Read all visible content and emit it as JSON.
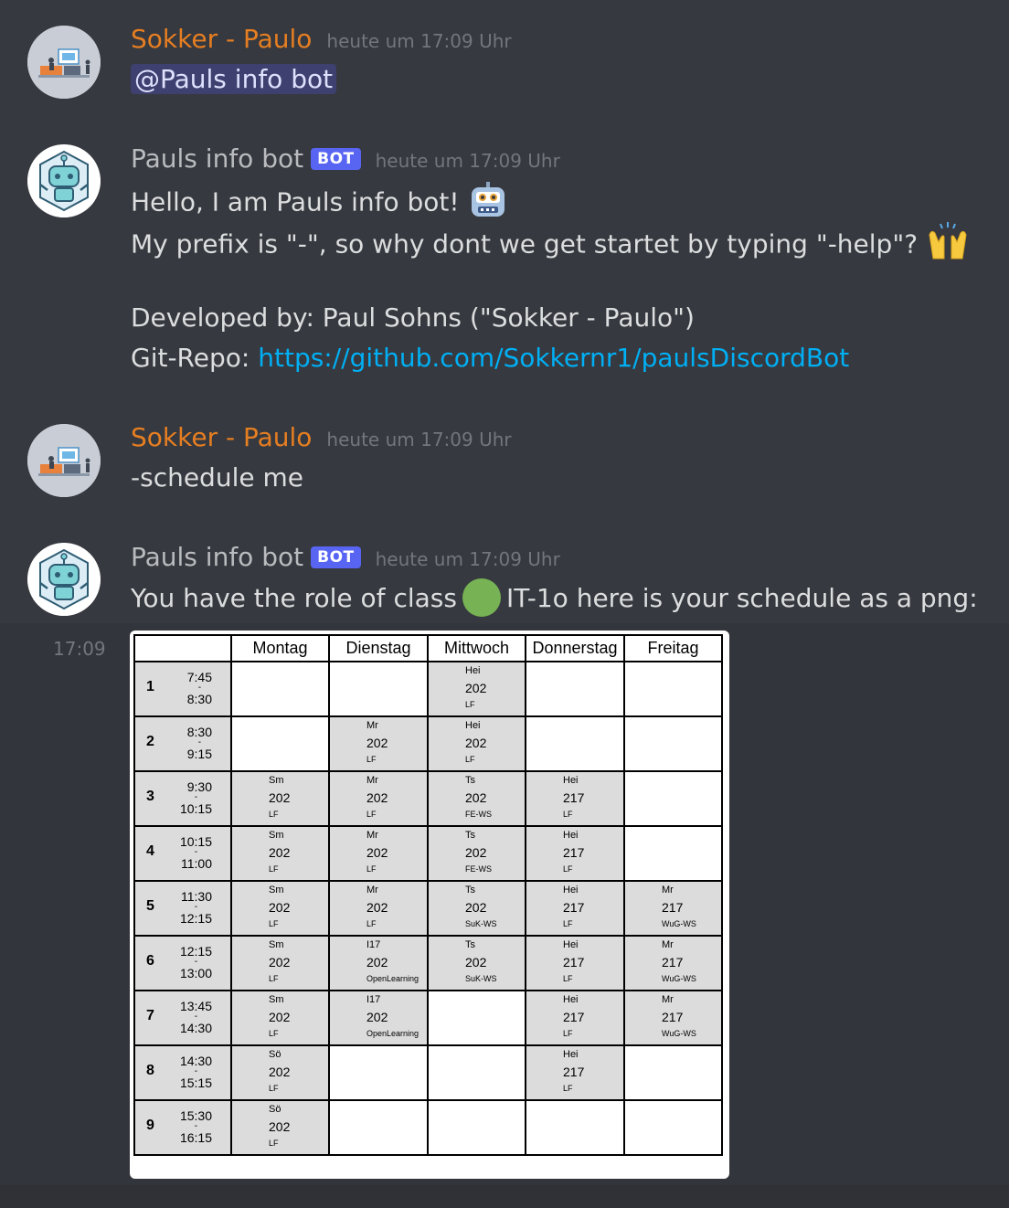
{
  "messages": [
    {
      "author": "Sokker - Paulo",
      "timestamp": "heute um 17:09 Uhr",
      "mention": "@Pauls info bot"
    },
    {
      "author": "Pauls info bot",
      "bot_tag": "BOT",
      "timestamp": "heute um 17:09 Uhr",
      "line1": "Hello, I am Pauls info bot!",
      "line2": "My prefix is \"-\", so why dont we get startet by typing \"-help\"?",
      "line3": "Developed by: Paul Sohns (\"Sokker - Paulo\")",
      "line4_label": "Git-Repo: ",
      "line4_link": "https://github.com/Sokkernr1/paulsDiscordBot"
    },
    {
      "author": "Sokker - Paulo",
      "timestamp": "heute um 17:09 Uhr",
      "text": "-schedule me"
    },
    {
      "author": "Pauls info bot",
      "bot_tag": "BOT",
      "timestamp": "heute um 17:09 Uhr",
      "text_before": "You have the role of class",
      "text_after": "IT-1o here is your schedule as a png:"
    }
  ],
  "side_timestamp": "17:09",
  "colors": {
    "user_name": "#e67e22",
    "bot_tag": "#5865f2",
    "link": "#00aff4",
    "background": "#36393f"
  },
  "icons": {
    "robot": "robot-emoji",
    "hands": "raising-hands-emoji",
    "circle": "green-circle-emoji"
  },
  "schedule": {
    "days": [
      "Montag",
      "Dienstag",
      "Mittwoch",
      "Donnerstag",
      "Freitag"
    ],
    "periods": [
      {
        "num": "1",
        "start": "7:45",
        "end": "8:30",
        "cells": [
          null,
          null,
          {
            "t": "Hei",
            "r": "202",
            "s": "LF"
          },
          null,
          null
        ]
      },
      {
        "num": "2",
        "start": "8:30",
        "end": "9:15",
        "cells": [
          null,
          {
            "t": "Mr",
            "r": "202",
            "s": "LF"
          },
          {
            "t": "Hei",
            "r": "202",
            "s": "LF"
          },
          null,
          null
        ]
      },
      {
        "num": "3",
        "start": "9:30",
        "end": "10:15",
        "cells": [
          {
            "t": "Sm",
            "r": "202",
            "s": "LF"
          },
          {
            "t": "Mr",
            "r": "202",
            "s": "LF"
          },
          {
            "t": "Ts",
            "r": "202",
            "s": "FE-WS"
          },
          {
            "t": "Hei",
            "r": "217",
            "s": "LF"
          },
          null
        ]
      },
      {
        "num": "4",
        "start": "10:15",
        "end": "11:00",
        "cells": [
          {
            "t": "Sm",
            "r": "202",
            "s": "LF"
          },
          {
            "t": "Mr",
            "r": "202",
            "s": "LF"
          },
          {
            "t": "Ts",
            "r": "202",
            "s": "FE-WS"
          },
          {
            "t": "Hei",
            "r": "217",
            "s": "LF"
          },
          null
        ]
      },
      {
        "num": "5",
        "start": "11:30",
        "end": "12:15",
        "cells": [
          {
            "t": "Sm",
            "r": "202",
            "s": "LF"
          },
          {
            "t": "Mr",
            "r": "202",
            "s": "LF"
          },
          {
            "t": "Ts",
            "r": "202",
            "s": "SuK-WS"
          },
          {
            "t": "Hei",
            "r": "217",
            "s": "LF"
          },
          {
            "t": "Mr",
            "r": "217",
            "s": "WuG-WS"
          }
        ]
      },
      {
        "num": "6",
        "start": "12:15",
        "end": "13:00",
        "cells": [
          {
            "t": "Sm",
            "r": "202",
            "s": "LF"
          },
          {
            "t": "I17",
            "r": "202",
            "s": "OpenLearning"
          },
          {
            "t": "Ts",
            "r": "202",
            "s": "SuK-WS"
          },
          {
            "t": "Hei",
            "r": "217",
            "s": "LF"
          },
          {
            "t": "Mr",
            "r": "217",
            "s": "WuG-WS"
          }
        ]
      },
      {
        "num": "7",
        "start": "13:45",
        "end": "14:30",
        "cells": [
          {
            "t": "Sm",
            "r": "202",
            "s": "LF"
          },
          {
            "t": "I17",
            "r": "202",
            "s": "OpenLearning"
          },
          null,
          {
            "t": "Hei",
            "r": "217",
            "s": "LF"
          },
          {
            "t": "Mr",
            "r": "217",
            "s": "WuG-WS"
          }
        ]
      },
      {
        "num": "8",
        "start": "14:30",
        "end": "15:15",
        "cells": [
          {
            "t": "Sö",
            "r": "202",
            "s": "LF"
          },
          null,
          null,
          {
            "t": "Hei",
            "r": "217",
            "s": "LF"
          },
          null
        ]
      },
      {
        "num": "9",
        "start": "15:30",
        "end": "16:15",
        "cells": [
          {
            "t": "Sö",
            "r": "202",
            "s": "LF"
          },
          null,
          null,
          null,
          null
        ]
      }
    ]
  }
}
